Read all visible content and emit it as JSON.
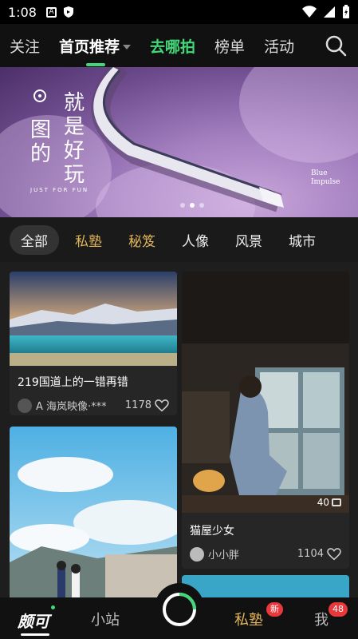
{
  "status_bar": {
    "time": "1:08",
    "icons": [
      "a-badge-icon",
      "shield-icon",
      "wifi-icon",
      "signal-icon",
      "battery-icon"
    ]
  },
  "top_nav": {
    "tabs": [
      {
        "label": "关注"
      },
      {
        "label": "首页推荐"
      },
      {
        "label": "去哪拍"
      },
      {
        "label": "榜单"
      },
      {
        "label": "活动"
      }
    ],
    "active_index": 1,
    "highlight_color": "#43d77a"
  },
  "banner": {
    "title_lines": [
      "就是好玩",
      "图的"
    ],
    "tagline": "JUST FOR FUN",
    "right_text": [
      "Blue",
      "Impulse"
    ],
    "dot_count": 3,
    "active_dot": 1
  },
  "categories": {
    "items": [
      "全部",
      "私塾",
      "秘笈",
      "人像",
      "风景",
      "城市"
    ],
    "selected_index": 0,
    "gold_items": [
      1,
      2
    ],
    "gold_color": "#e0b45a"
  },
  "feed": {
    "cards": [
      {
        "title": "219国道上的一错再错",
        "author": "A 海岚映像·***",
        "likes": "1178"
      },
      {
        "title": "猫屋少女",
        "author": "小小胖",
        "likes": "1104",
        "photo_count": "40"
      }
    ]
  },
  "bottom_nav": {
    "items": [
      {
        "label": "颇可"
      },
      {
        "label": "小站"
      },
      {
        "label": "私塾",
        "badge": "新"
      },
      {
        "label": "我",
        "badge": "48"
      }
    ],
    "accent_color": "#43d77a",
    "badge_color": "#e8383b"
  }
}
